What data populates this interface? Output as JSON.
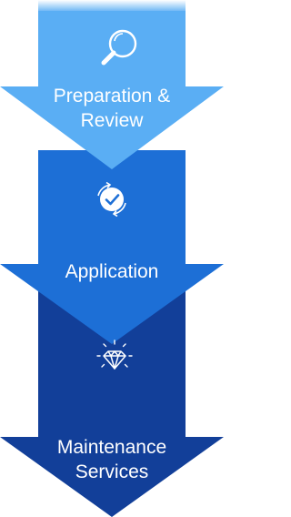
{
  "steps": [
    {
      "label": "Preparation &\nReview",
      "icon": "magnifier-icon",
      "color": "#5aaef4"
    },
    {
      "label": "Application",
      "icon": "check-cycle-icon",
      "color": "#1d6fd6"
    },
    {
      "label": "Maintenance\nServices",
      "icon": "diamond-icon",
      "color": "#123f99"
    }
  ]
}
